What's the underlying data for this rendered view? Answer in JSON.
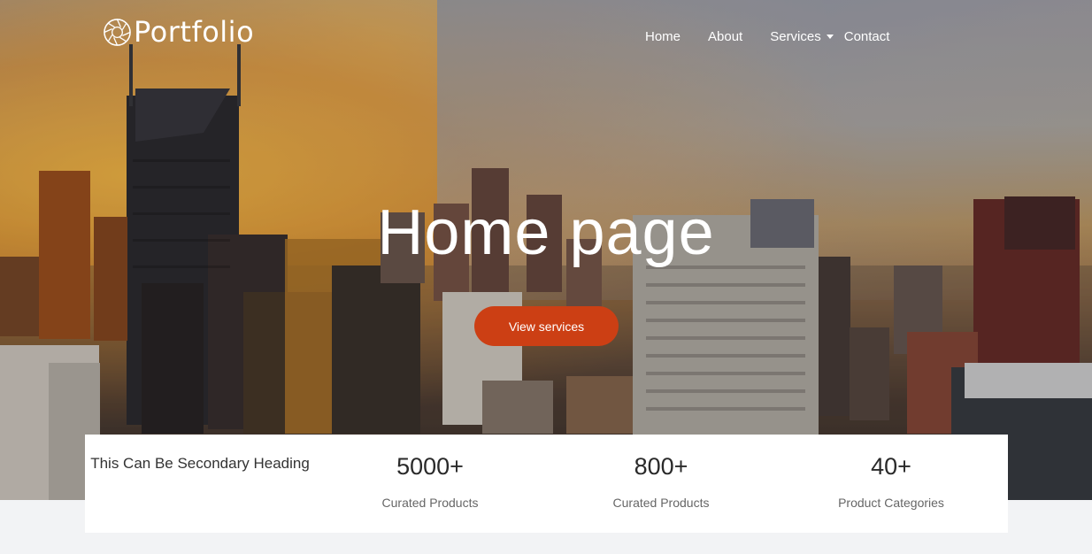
{
  "brand": {
    "name": "Portfolio"
  },
  "nav": {
    "home": "Home",
    "about": "About",
    "services": "Services",
    "contact": "Contact"
  },
  "hero": {
    "title": "Home page",
    "cta_label": "View services"
  },
  "stats": {
    "heading": "This Can Be Secondary Heading",
    "items": [
      {
        "value": "5000+",
        "label": "Curated Products"
      },
      {
        "value": "800+",
        "label": "Curated Products"
      },
      {
        "value": "40+",
        "label": "Product Categories"
      }
    ]
  },
  "colors": {
    "accent": "#cc3f14",
    "panel": "#ffffff",
    "page_bg": "#f2f3f5"
  },
  "icons": {
    "logo": "aperture-logo-icon",
    "services_dropdown": "caret-down-icon"
  }
}
